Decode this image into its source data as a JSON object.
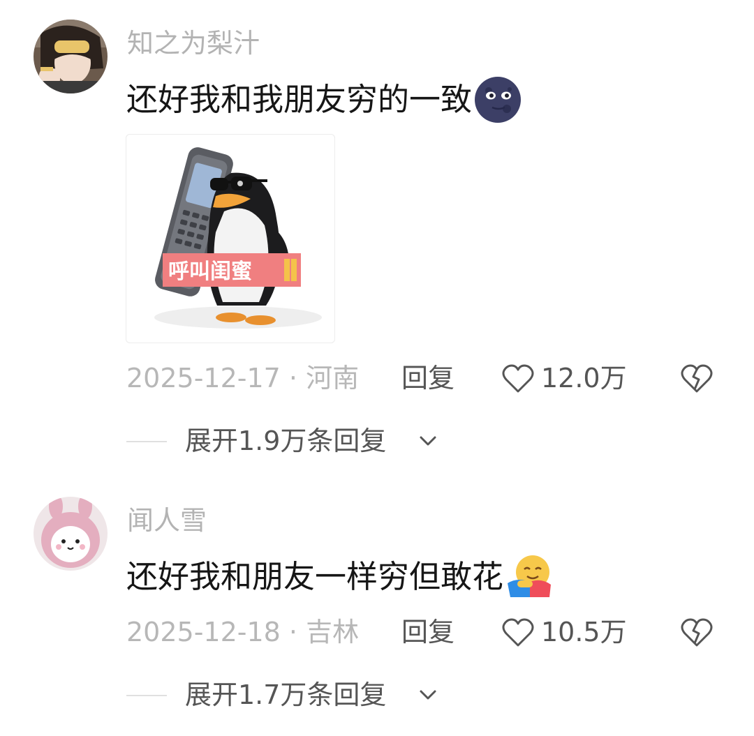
{
  "comments": [
    {
      "username": "知之为梨汁",
      "text": "还好我和我朋友穷的一致",
      "emoji": "new-moon-face-emoji",
      "sticker": {
        "name": "penguin-phone-sticker",
        "caption": "呼叫闺蜜"
      },
      "date_location": "2025-12-17 · 河南",
      "reply_label": "回复",
      "like_count": "12.0万",
      "expand_label": "展开1.9万条回复"
    },
    {
      "username": "闻人雪",
      "text": "还好我和朋友一样穷但敢花",
      "emoji": "hugging-face-emoji",
      "date_location": "2025-12-18 · 吉林",
      "reply_label": "回复",
      "like_count": "10.5万",
      "expand_label": "展开1.7万条回复"
    }
  ],
  "colors": {
    "username": "#b3b3b3",
    "text": "#161616",
    "meta": "#b7b7b7",
    "action": "#555555",
    "sticker_banner": "#f07f80"
  }
}
